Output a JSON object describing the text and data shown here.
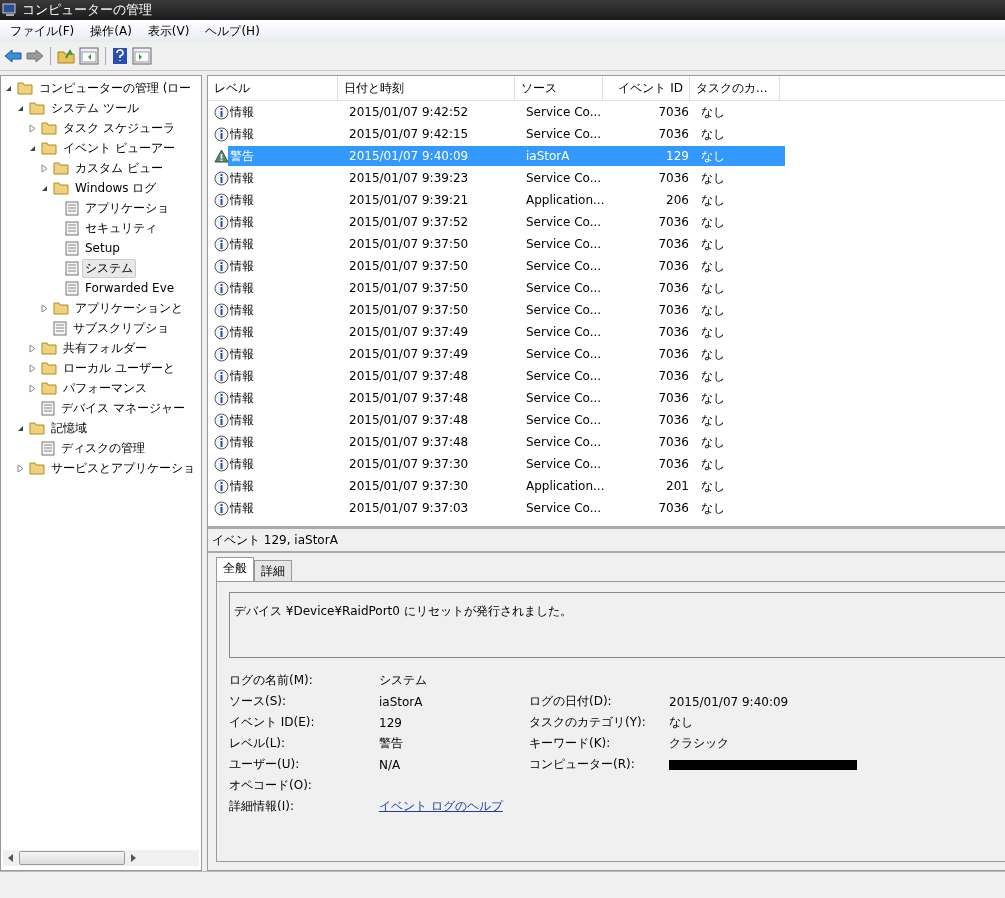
{
  "window": {
    "title": "コンピューターの管理"
  },
  "menu": [
    "ファイル(F)",
    "操作(A)",
    "表示(V)",
    "ヘルプ(H)"
  ],
  "tree": [
    {
      "label": "コンピューターの管理 (ロー",
      "expanded": true,
      "children": [
        {
          "label": "システム ツール",
          "expanded": true,
          "children": [
            {
              "label": "タスク スケジューラ",
              "expanded": false
            },
            {
              "label": "イベント ビューアー",
              "expanded": true,
              "children": [
                {
                  "label": "カスタム ビュー",
                  "expanded": false
                },
                {
                  "label": "Windows ログ",
                  "expanded": true,
                  "children": [
                    {
                      "label": "アプリケーショ",
                      "selected": false
                    },
                    {
                      "label": "セキュリティ",
                      "selected": false
                    },
                    {
                      "label": "Setup",
                      "selected": false
                    },
                    {
                      "label": "システム",
                      "selected": true
                    },
                    {
                      "label": "Forwarded Eve",
                      "selected": false
                    }
                  ]
                },
                {
                  "label": "アプリケーションと",
                  "expanded": false
                },
                {
                  "label": "サブスクリプショ",
                  "selected": false
                }
              ]
            },
            {
              "label": "共有フォルダー",
              "expanded": false
            },
            {
              "label": "ローカル ユーザーと",
              "expanded": false
            },
            {
              "label": "パフォーマンス",
              "expanded": false
            },
            {
              "label": "デバイス マネージャー",
              "selected": false
            }
          ]
        },
        {
          "label": "記憶域",
          "expanded": true,
          "children": [
            {
              "label": "ディスクの管理",
              "selected": false
            }
          ]
        },
        {
          "label": "サービスとアプリケーショ",
          "expanded": false
        }
      ]
    }
  ],
  "events": {
    "columns": [
      "レベル",
      "日付と時刻",
      "ソース",
      "イベント ID",
      "タスクのカ..."
    ],
    "rows": [
      {
        "kind": "info",
        "level": "情報",
        "time": "2015/01/07 9:42:52",
        "source": "Service Co...",
        "id": "7036",
        "task": "なし",
        "selected": false
      },
      {
        "kind": "info",
        "level": "情報",
        "time": "2015/01/07 9:42:15",
        "source": "Service Co...",
        "id": "7036",
        "task": "なし",
        "selected": false
      },
      {
        "kind": "warning",
        "level": "警告",
        "time": "2015/01/07 9:40:09",
        "source": "iaStorA",
        "id": "129",
        "task": "なし",
        "selected": true
      },
      {
        "kind": "info",
        "level": "情報",
        "time": "2015/01/07 9:39:23",
        "source": "Service Co...",
        "id": "7036",
        "task": "なし",
        "selected": false
      },
      {
        "kind": "info",
        "level": "情報",
        "time": "2015/01/07 9:39:21",
        "source": "Application...",
        "id": "206",
        "task": "なし",
        "selected": false
      },
      {
        "kind": "info",
        "level": "情報",
        "time": "2015/01/07 9:37:52",
        "source": "Service Co...",
        "id": "7036",
        "task": "なし",
        "selected": false
      },
      {
        "kind": "info",
        "level": "情報",
        "time": "2015/01/07 9:37:50",
        "source": "Service Co...",
        "id": "7036",
        "task": "なし",
        "selected": false
      },
      {
        "kind": "info",
        "level": "情報",
        "time": "2015/01/07 9:37:50",
        "source": "Service Co...",
        "id": "7036",
        "task": "なし",
        "selected": false
      },
      {
        "kind": "info",
        "level": "情報",
        "time": "2015/01/07 9:37:50",
        "source": "Service Co...",
        "id": "7036",
        "task": "なし",
        "selected": false
      },
      {
        "kind": "info",
        "level": "情報",
        "time": "2015/01/07 9:37:50",
        "source": "Service Co...",
        "id": "7036",
        "task": "なし",
        "selected": false
      },
      {
        "kind": "info",
        "level": "情報",
        "time": "2015/01/07 9:37:49",
        "source": "Service Co...",
        "id": "7036",
        "task": "なし",
        "selected": false
      },
      {
        "kind": "info",
        "level": "情報",
        "time": "2015/01/07 9:37:49",
        "source": "Service Co...",
        "id": "7036",
        "task": "なし",
        "selected": false
      },
      {
        "kind": "info",
        "level": "情報",
        "time": "2015/01/07 9:37:48",
        "source": "Service Co...",
        "id": "7036",
        "task": "なし",
        "selected": false
      },
      {
        "kind": "info",
        "level": "情報",
        "time": "2015/01/07 9:37:48",
        "source": "Service Co...",
        "id": "7036",
        "task": "なし",
        "selected": false
      },
      {
        "kind": "info",
        "level": "情報",
        "time": "2015/01/07 9:37:48",
        "source": "Service Co...",
        "id": "7036",
        "task": "なし",
        "selected": false
      },
      {
        "kind": "info",
        "level": "情報",
        "time": "2015/01/07 9:37:48",
        "source": "Service Co...",
        "id": "7036",
        "task": "なし",
        "selected": false
      },
      {
        "kind": "info",
        "level": "情報",
        "time": "2015/01/07 9:37:30",
        "source": "Service Co...",
        "id": "7036",
        "task": "なし",
        "selected": false
      },
      {
        "kind": "info",
        "level": "情報",
        "time": "2015/01/07 9:37:30",
        "source": "Application...",
        "id": "201",
        "task": "なし",
        "selected": false
      },
      {
        "kind": "info",
        "level": "情報",
        "time": "2015/01/07 9:37:03",
        "source": "Service Co...",
        "id": "7036",
        "task": "なし",
        "selected": false
      }
    ]
  },
  "detail": {
    "header": "イベント 129, iaStorA",
    "tabs": [
      {
        "label": "全般",
        "selected": true
      },
      {
        "label": "詳細",
        "selected": false
      }
    ],
    "message": "デバイス ¥Device¥RaidPort0 にリセットが発行されました。",
    "left_fields": [
      {
        "label": "ログの名前(M):",
        "value": "システム"
      },
      {
        "label": "ソース(S):",
        "value": "iaStorA"
      },
      {
        "label": "イベント ID(E):",
        "value": "129"
      },
      {
        "label": "レベル(L):",
        "value": "警告"
      },
      {
        "label": "ユーザー(U):",
        "value": "N/A"
      },
      {
        "label": "オペコード(O):"
      },
      {
        "label": "詳細情報(I):",
        "value": "イベント ログのヘルプ",
        "kind": "link"
      }
    ],
    "right_fields": [
      {
        "label": "ログの日付(D):",
        "value": "2015/01/07 9:40:09"
      },
      {
        "label": "タスクのカテゴリ(Y):",
        "value": "なし"
      },
      {
        "label": "キーワード(K):",
        "value": "クラシック"
      },
      {
        "label": "コンピューター(R):",
        "redacted": true
      }
    ]
  }
}
